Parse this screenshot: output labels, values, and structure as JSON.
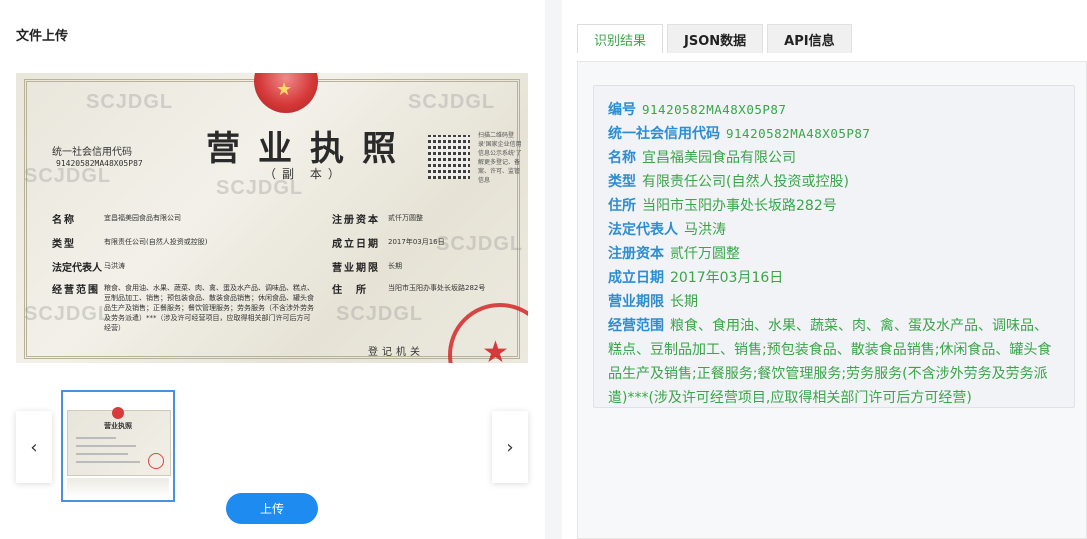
{
  "left": {
    "title": "文件上传",
    "upload_button": "上传",
    "prev_icon": "chevron-left-icon",
    "next_icon": "chevron-right-icon"
  },
  "license_image": {
    "watermark": "SCJDGL",
    "title": "营业执照",
    "subtitle": "（副 本）",
    "code_label": "统一社会信用代码",
    "code_value": "91420582MA48X05P87",
    "qr_note": "扫描二维码登录'国家企业信用信息公示系统'了解更多登记、备案、许可、监管信息",
    "fields": {
      "name_label": "名称",
      "name_value": "宜昌福美园食品有限公司",
      "type_label": "类型",
      "type_value": "有限责任公司(自然人投资或控股)",
      "rep_label": "法定代表人",
      "rep_value": "马洪涛",
      "scope_label": "经营范围",
      "scope_value": "粮食、食用油、水果、蔬菜、肉、禽、蛋及水产品、调味品、糕点、豆制品加工、销售；预包装食品、散装食品销售；休闲食品、罐头食品生产及销售；正餐服务；餐饮管理服务；劳务服务（不含涉外劳务及劳务派遣）***（涉及许可经营项目，应取得相关部门许可后方可经营）",
      "capital_label": "注册资本",
      "capital_value": "贰仟万圆整",
      "date_label": "成立日期",
      "date_value": "2017年03月16日",
      "term_label": "营业期限",
      "term_value": "长期",
      "address_label": "住所",
      "address_value": "当阳市玉阳办事处长坂路282号",
      "authority": "登记机关"
    }
  },
  "right": {
    "tabs": [
      {
        "label": "识别结果",
        "active": true
      },
      {
        "label": "JSON数据",
        "active": false
      },
      {
        "label": "API信息",
        "active": false
      }
    ],
    "results": [
      {
        "key": "编号",
        "value": "91420582MA48X05P87",
        "mono": true
      },
      {
        "key": "统一社会信用代码",
        "value": "91420582MA48X05P87",
        "mono": true
      },
      {
        "key": "名称",
        "value": "宜昌福美园食品有限公司"
      },
      {
        "key": "类型",
        "value": "有限责任公司(自然人投资或控股)"
      },
      {
        "key": "住所",
        "value": "当阳市玉阳办事处长坂路282号"
      },
      {
        "key": "法定代表人",
        "value": "马洪涛"
      },
      {
        "key": "注册资本",
        "value": "贰仟万圆整"
      },
      {
        "key": "成立日期",
        "value": "2017年03月16日",
        "mono": true
      },
      {
        "key": "营业期限",
        "value": "长期"
      },
      {
        "key": "经营范围",
        "value": "粮食、食用油、水果、蔬菜、肉、禽、蛋及水产品、调味品、糕点、豆制品加工、销售;预包装食品、散装食品销售;休闲食品、罐头食品生产及销售;正餐服务;餐饮管理服务;劳务服务(不含涉外劳务及劳务派遣)***(涉及许可经营项目,应取得相关部门许可后方可经营)"
      }
    ]
  },
  "colors": {
    "key_blue": "#2b8ed3",
    "value_green": "#3aa54b",
    "upload_blue": "#1e8bf0"
  }
}
